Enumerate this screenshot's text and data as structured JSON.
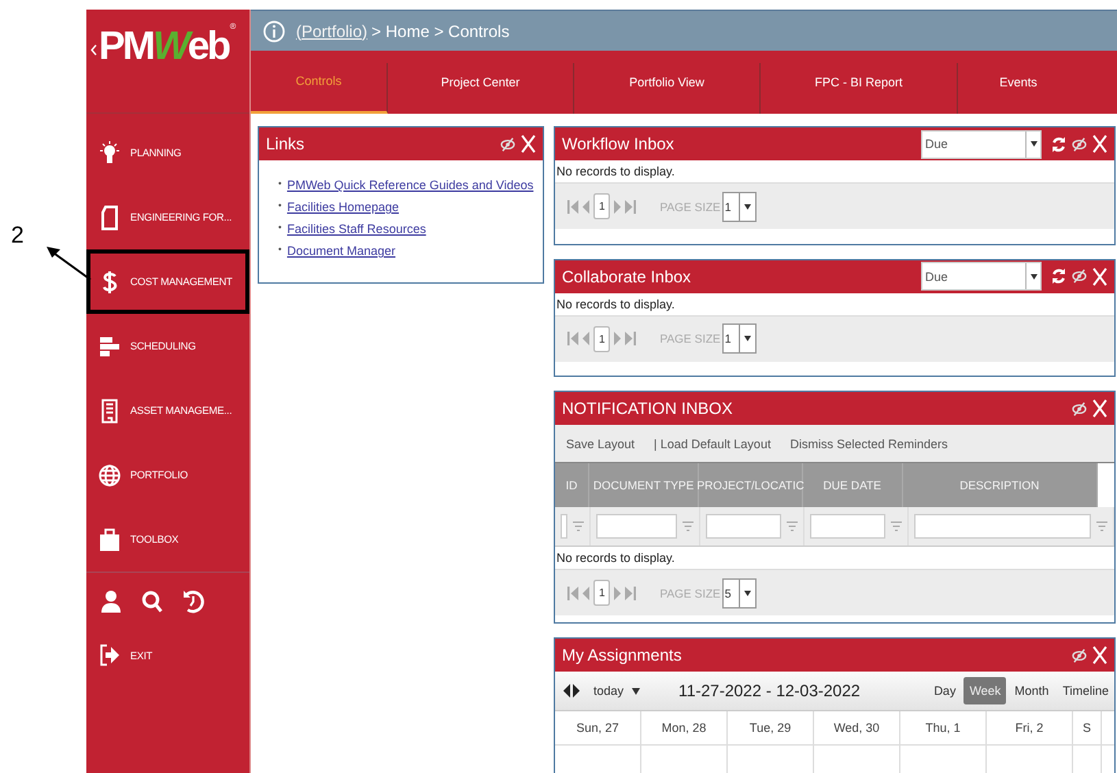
{
  "annotation": {
    "label": "2"
  },
  "logo": {
    "prefix": "PM",
    "accent": "W",
    "suffix": "eb",
    "mark": "®"
  },
  "sidebar": {
    "items": [
      {
        "label": "PLANNING",
        "highlighted": false
      },
      {
        "label": "ENGINEERING FOR...",
        "highlighted": false
      },
      {
        "label": "COST MANAGEMENT",
        "highlighted": true
      },
      {
        "label": "SCHEDULING",
        "highlighted": false
      },
      {
        "label": "ASSET MANAGEME...",
        "highlighted": false
      },
      {
        "label": "PORTFOLIO",
        "highlighted": false
      },
      {
        "label": "TOOLBOX",
        "highlighted": false
      }
    ],
    "exit": "EXIT"
  },
  "breadcrumb": {
    "link": "(Portfolio)",
    "path": "> Home > Controls"
  },
  "tabs": [
    {
      "label": "Controls",
      "selected": true
    },
    {
      "label": "Project Center",
      "selected": false
    },
    {
      "label": "Portfolio View",
      "selected": false
    },
    {
      "label": "FPC - BI Report",
      "selected": false
    },
    {
      "label": "Events",
      "selected": false
    }
  ],
  "links_panel": {
    "title": "Links",
    "links": [
      {
        "marker": "•",
        "text": "PMWeb Quick Reference Guides and Videos"
      },
      {
        "marker": "•",
        "text": "Facilities Homepage"
      },
      {
        "marker": "•",
        "text": "Facilities Staff Resources"
      },
      {
        "marker": "•",
        "text": "Document Manager"
      }
    ]
  },
  "inboxes": [
    {
      "title": "Workflow Inbox",
      "filter": "Due",
      "message": "No records to display.",
      "page": "1",
      "page_size_label": "PAGE SIZE",
      "page_size": "1"
    },
    {
      "title": "Collaborate Inbox",
      "filter": "Due",
      "message": "No records to display.",
      "page": "1",
      "page_size_label": "PAGE SIZE",
      "page_size": "1"
    }
  ],
  "notification": {
    "title": "NOTIFICATION INBOX",
    "actions": [
      "Save Layout",
      "| Load Default Layout",
      "Dismiss Selected Reminders"
    ],
    "columns": [
      "ID",
      "DOCUMENT TYPE",
      "PROJECT/LOCATIC",
      "DUE DATE",
      "DESCRIPTION"
    ],
    "message": "No records to display.",
    "page": "1",
    "page_size_label": "PAGE SIZE",
    "page_size": "5"
  },
  "assignments": {
    "title": "My Assignments",
    "today": "today",
    "range": "11-27-2022 - 12-03-2022",
    "views": [
      {
        "label": "Day",
        "selected": false
      },
      {
        "label": "Week",
        "selected": true
      },
      {
        "label": "Month",
        "selected": false
      },
      {
        "label": "Timeline",
        "selected": false
      }
    ],
    "days": [
      "Sun, 27",
      "Mon, 28",
      "Tue, 29",
      "Wed, 30",
      "Thu, 1",
      "Fri, 2",
      "S"
    ]
  }
}
